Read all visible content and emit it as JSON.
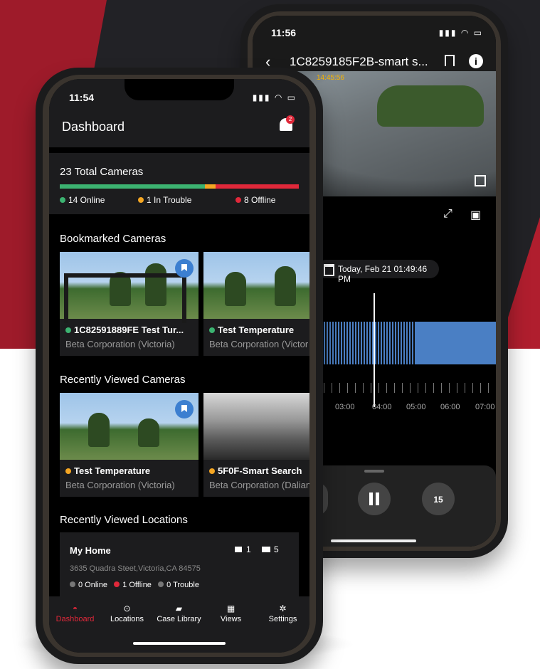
{
  "back_phone": {
    "status_time": "11:56",
    "status_icons": "▮▮▮ ◠ ▭",
    "nav_back_icon": "chevron-left",
    "title": "1C8259185F2B-smart s...",
    "video_timestamp": "14:45:56",
    "date_label": "Today, Feb 21 01:49:46 PM",
    "timeline_labels": [
      "03:00",
      "04:00",
      "05:00",
      "06:00",
      "07:00"
    ],
    "skip_label": "15"
  },
  "front_phone": {
    "status_time": "11:54",
    "status_icons": "▮▮▮ ◠ ▭",
    "header_title": "Dashboard",
    "notification_count": "2",
    "total": {
      "title": "23 Total Cameras",
      "online_count": 14,
      "trouble_count": 1,
      "offline_count": 8,
      "online_label": "14 Online",
      "trouble_label": "1 In Trouble",
      "offline_label": "8 Offline",
      "colors": {
        "online": "#3cb371",
        "trouble": "#f5a623",
        "offline": "#e0283a"
      }
    },
    "bookmarked": {
      "title": "Bookmarked Cameras",
      "cards": [
        {
          "name": "1C82591889FE Test Tur...",
          "location": "Beta Corporation (Victoria)",
          "status_color": "#3cb371"
        },
        {
          "name": "Test Temperature",
          "location": "Beta Corporation (Victor",
          "status_color": "#3cb371"
        }
      ]
    },
    "recent": {
      "title": "Recently Viewed Cameras",
      "cards": [
        {
          "name": "Test Temperature",
          "location": "Beta Corporation (Victoria)",
          "status_color": "#f5a623"
        },
        {
          "name": "5F0F-Smart Search",
          "location": "Beta Corporation (Dalian",
          "status_color": "#f5a623"
        }
      ]
    },
    "recent_locations": {
      "title": "Recently Viewed Locations",
      "card": {
        "name": "My Home",
        "camera_count": "1",
        "folder_count": "5",
        "address": "3635 Quadra Steet,Victoria,CA 84575",
        "online": "0 Online",
        "offline": "1 Offline",
        "trouble": "0 Trouble"
      }
    },
    "tabs": [
      {
        "label": "Dashboard",
        "icon": "gauge-icon",
        "active": true
      },
      {
        "label": "Locations",
        "icon": "pin-icon",
        "active": false
      },
      {
        "label": "Case Library",
        "icon": "folder-icon",
        "active": false
      },
      {
        "label": "Views",
        "icon": "grid-icon",
        "active": false
      },
      {
        "label": "Settings",
        "icon": "gear-icon",
        "active": false
      }
    ]
  }
}
